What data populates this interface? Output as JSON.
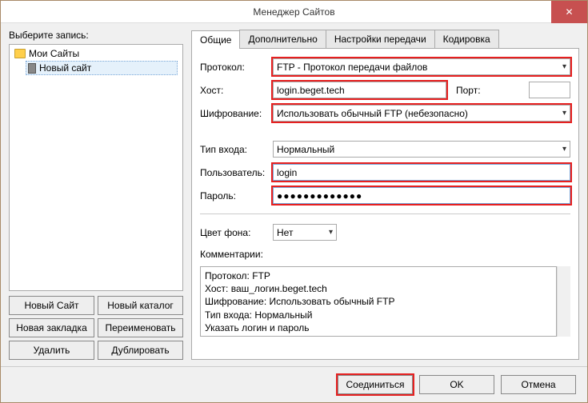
{
  "window": {
    "title": "Менеджер Сайтов"
  },
  "left": {
    "label": "Выберите запись:",
    "root": "Мои Сайты",
    "child": "Новый сайт",
    "buttons": {
      "new_site": "Новый Сайт",
      "new_folder": "Новый каталог",
      "new_bookmark": "Новая закладка",
      "rename": "Переименовать",
      "delete": "Удалить",
      "duplicate": "Дублировать"
    }
  },
  "tabs": {
    "general": "Общие",
    "advanced": "Дополнительно",
    "transfer": "Настройки передачи",
    "charset": "Кодировка"
  },
  "form": {
    "protocol_label": "Протокол:",
    "protocol_value": "FTP - Протокол передачи файлов",
    "host_label": "Хост:",
    "host_value": "login.beget.tech",
    "port_label": "Порт:",
    "port_value": "",
    "encryption_label": "Шифрование:",
    "encryption_value": "Использовать обычный FTP (небезопасно)",
    "logon_label": "Тип входа:",
    "logon_value": "Нормальный",
    "user_label": "Пользователь:",
    "user_value": "login",
    "pass_label": "Пароль:",
    "pass_value": "●●●●●●●●●●●●●",
    "bgcolor_label": "Цвет фона:",
    "bgcolor_value": "Нет",
    "comments_label": "Комментарии:",
    "comments_lines": [
      "Протокол: FTP",
      "Хост: ваш_логин.beget.tech",
      "Шифрование: Использовать обычный FTP",
      "Тип входа: Нормальный",
      "Указать логин и пароль"
    ]
  },
  "footer": {
    "connect": "Соединиться",
    "ok": "OK",
    "cancel": "Отмена"
  }
}
